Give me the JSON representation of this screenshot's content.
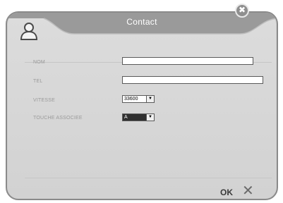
{
  "dialog": {
    "title": "Contact",
    "close_glyph": "✖"
  },
  "fields": {
    "nom_label": "NOM",
    "nom_value": "",
    "tel_label": "TEL",
    "tel_value": "",
    "vitesse_label": "VITESSE",
    "vitesse_value": "33600",
    "touche_label": "TOUCHE ASSOCIEE",
    "touche_value": "A"
  },
  "footer": {
    "ok_label": "OK",
    "cancel_glyph": "✕"
  },
  "icons": {
    "contact": "user-icon",
    "close": "close-icon",
    "cancel": "cancel-x-icon"
  }
}
